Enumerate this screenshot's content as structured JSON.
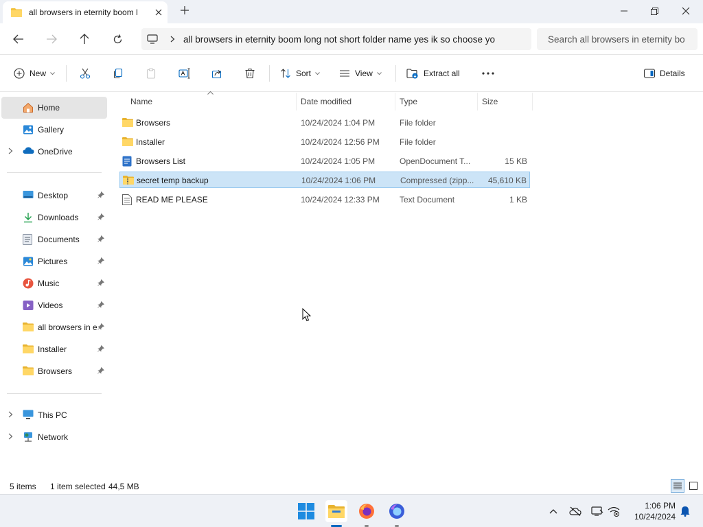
{
  "window": {
    "tab_title": "all browsers in eternity boom l",
    "minimize": "—",
    "maximize": "☐",
    "close": "✕"
  },
  "address": {
    "path": "all browsers in eternity boom long not short folder name yes ik so choose yo",
    "search_placeholder": "Search all browsers in eternity bo"
  },
  "commandbar": {
    "new_label": "New",
    "sort_label": "Sort",
    "view_label": "View",
    "extract_label": "Extract all",
    "details_label": "Details"
  },
  "sidebar": {
    "home": "Home",
    "gallery": "Gallery",
    "onedrive": "OneDrive",
    "desktop": "Desktop",
    "downloads": "Downloads",
    "documents": "Documents",
    "pictures": "Pictures",
    "music": "Music",
    "videos": "Videos",
    "all_browsers": "all browsers in e",
    "installer": "Installer",
    "browsers": "Browsers",
    "this_pc": "This PC",
    "network": "Network"
  },
  "columns": {
    "name": "Name",
    "date": "Date modified",
    "type": "Type",
    "size": "Size"
  },
  "files": [
    {
      "name": "Browsers",
      "date": "10/24/2024 1:04 PM",
      "type": "File folder",
      "size": "",
      "icon": "folder-icon"
    },
    {
      "name": "Installer",
      "date": "10/24/2024 12:56 PM",
      "type": "File folder",
      "size": "",
      "icon": "folder-icon"
    },
    {
      "name": "Browsers List",
      "date": "10/24/2024 1:05 PM",
      "type": "OpenDocument T...",
      "size": "15 KB",
      "icon": "document-icon"
    },
    {
      "name": "secret temp backup",
      "date": "10/24/2024 1:06 PM",
      "type": "Compressed (zipp...",
      "size": "45,610 KB",
      "icon": "zip-folder-icon"
    },
    {
      "name": "READ ME PLEASE",
      "date": "10/24/2024 12:33 PM",
      "type": "Text Document",
      "size": "1 KB",
      "icon": "text-file-icon"
    }
  ],
  "status": {
    "item_count": "5 items",
    "selection": "1 item selected",
    "selection_size": "44,5 MB"
  },
  "taskbar": {
    "time": "1:06 PM",
    "date": "10/24/2024"
  },
  "colors": {
    "accent": "#0067c0",
    "selection_bg": "#cce4f7",
    "folder": "#f3c33f"
  }
}
